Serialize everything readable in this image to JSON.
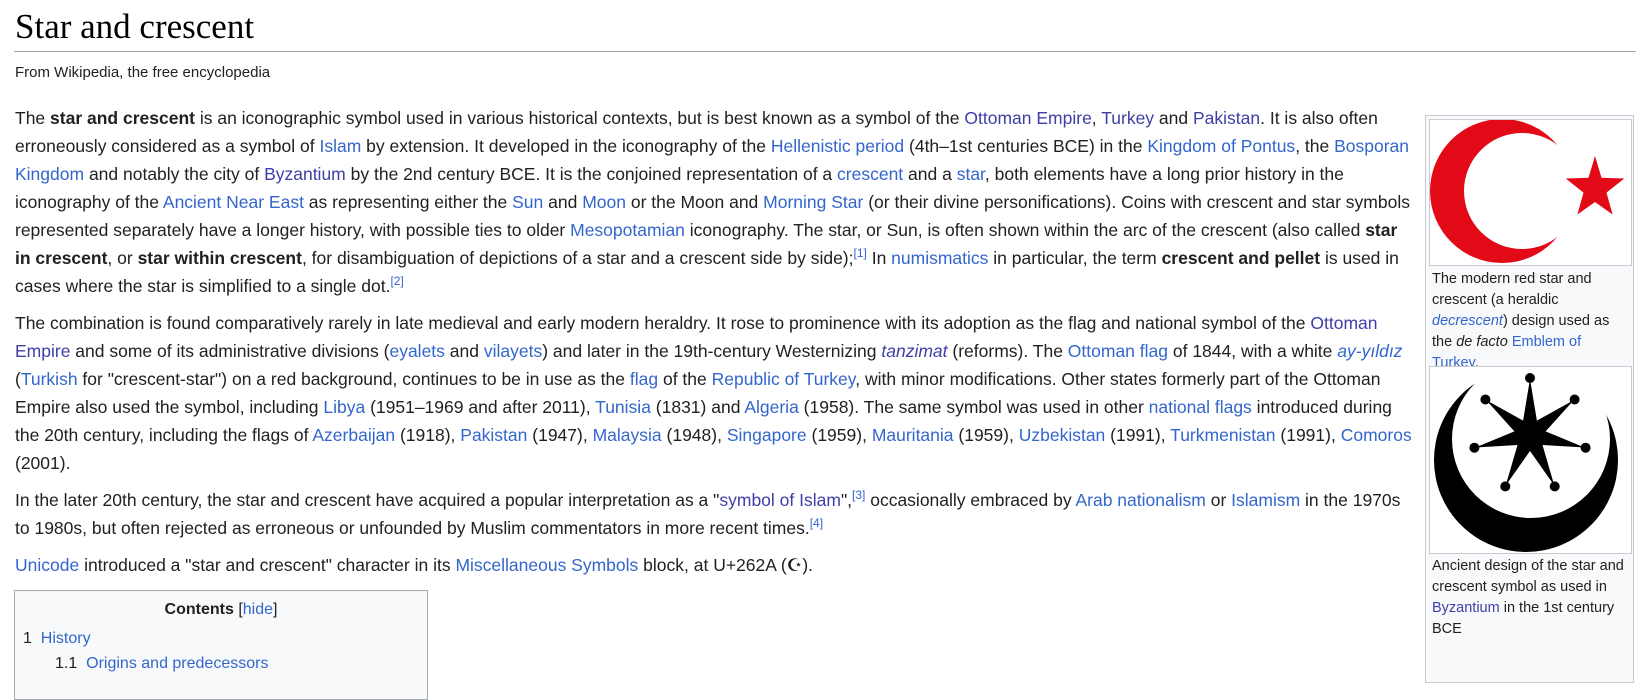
{
  "header": {
    "title": "Star and crescent",
    "tagline": "From Wikipedia, the free encyclopedia"
  },
  "para1": {
    "t1": "The ",
    "b1": "star and crescent",
    "t2": " is an iconographic symbol used in various historical contexts, but is best known as a symbol of the ",
    "l_ottoman": "Ottoman Empire",
    "t3": ", ",
    "l_turkey": "Turkey",
    "t4": " and ",
    "l_pakistan": "Pakistan",
    "t5": ". It is also often erroneously considered as a symbol of ",
    "l_islam": "Islam",
    "t6": " by extension. It developed in the iconography of the ",
    "l_hellenistic": "Hellenistic period",
    "t7": " (4th–1st centuries BCE) in the ",
    "l_pontus": "Kingdom of Pontus",
    "t8": ", the ",
    "l_bosporan": "Bosporan Kingdom",
    "t9": " and notably the city of ",
    "l_byzantium": "Byzantium",
    "t10": " by the 2nd century BCE. It is the conjoined representation of a ",
    "l_crescent": "crescent",
    "t11": " and a ",
    "l_star": "star",
    "t12": ", both elements have a long prior history in the iconography of the ",
    "l_ane": "Ancient Near East",
    "t13": " as representing either the ",
    "l_sun": "Sun",
    "t14": " and ",
    "l_moon": "Moon",
    "t15": " or the Moon and ",
    "l_morning": "Morning Star",
    "t16": " (or their divine personifications). Coins with crescent and star symbols represented separately have a longer history, with possible ties to older ",
    "l_meso": "Mesopotamian",
    "t17": " iconography. The star, or Sun, is often shown within the arc of the crescent (also called ",
    "b2": "star in crescent",
    "t18": ", or ",
    "b3": "star within crescent",
    "t19": ", for disambiguation of depictions of a star and a crescent side by side);",
    "ref1": "[1]",
    "t20": " In ",
    "l_numis": "numismatics",
    "t21": " in particular, the term ",
    "b4": "crescent and pellet",
    "t22": " is used in cases where the star is simplified to a single dot.",
    "ref2": "[2]"
  },
  "para2": {
    "t1": "The combination is found comparatively rarely in late medieval and early modern heraldry. It rose to prominence with its adoption as the flag and national symbol of the ",
    "l_ottoman": "Ottoman Empire",
    "t2": " and some of its administrative divisions (",
    "l_eyalets": "eyalets",
    "t3": " and ",
    "l_vilayets": "vilayets",
    "t4": ") and later in the 19th-century Westernizing ",
    "l_tanzimat": "tanzimat",
    "t5": " (reforms). The ",
    "l_oflag": "Ottoman flag",
    "t6": " of 1844, with a white ",
    "l_ay": "ay-yıldız",
    "t7": " (",
    "l_turkish": "Turkish",
    "t8": " for \"crescent-star\") on a red background, continues to be in use as the ",
    "l_flag": "flag",
    "t9": " of the ",
    "l_rot": "Republic of Turkey",
    "t10": ", with minor modifications. Other states formerly part of the Ottoman Empire also used the symbol, including ",
    "l_libya": "Libya",
    "t11": " (1951–1969 and after 2011), ",
    "l_tunisia": "Tunisia",
    "t12": " (1831) and ",
    "l_algeria": "Algeria",
    "t13": " (1958). The same symbol was used in other ",
    "l_nflags": "national flags",
    "t14": " introduced during the 20th century, including the flags of ",
    "l_azer": "Azerbaijan",
    "t15": " (1918), ",
    "l_pak": "Pakistan",
    "t16": " (1947), ",
    "l_malay": "Malaysia",
    "t17": " (1948), ",
    "l_sing": "Singapore",
    "t18": " (1959), ",
    "l_maur": "Mauritania",
    "t19": " (1959), ",
    "l_uzb": "Uzbekistan",
    "t20": " (1991), ",
    "l_turkm": "Turkmenistan",
    "t21": " (1991), ",
    "l_comoros": "Comoros",
    "t22": " (2001)."
  },
  "para3": {
    "t1": "In the later 20th century, the star and crescent have acquired a popular interpretation as a \"",
    "l_soi": "symbol of Islam",
    "t2": "\",",
    "ref3": "[3]",
    "t3": " occasionally embraced by ",
    "l_arab": "Arab nationalism",
    "t4": " or ",
    "l_islamism": "Islamism",
    "t5": " in the 1970s to 1980s, but often rejected as erroneous or unfounded by Muslim commentators in more recent times.",
    "ref4": "[4]"
  },
  "para4": {
    "l_unicode": "Unicode",
    "t1": " introduced a \"star and crescent\" character in its ",
    "l_misc": "Miscellaneous Symbols",
    "t2": " block, at U+262A (",
    "glyph": "☪",
    "t3": ")."
  },
  "infobox": {
    "cap1_t1": "The modern red star and crescent (a heraldic ",
    "cap1_i1": "decrescent",
    "cap1_t2": ") design used as the ",
    "cap1_i2": "de facto",
    "cap1_t3": " ",
    "cap1_l1": "Emblem of Turkey",
    "cap1_t4": ".",
    "cap2_t1": "Ancient design of the star and crescent symbol as used in ",
    "cap2_l1": "Byzantium",
    "cap2_t2": " in the 1st century BCE"
  },
  "toc": {
    "title": "Contents",
    "hide_open": "[",
    "hide": "hide",
    "hide_close": "]",
    "items": [
      {
        "num": "1",
        "label": "History"
      },
      {
        "num": "1.1",
        "label": "Origins and predecessors"
      }
    ]
  },
  "colors": {
    "link": "#3366cc",
    "visited_link": "#3e3ea6",
    "emblem_red": "#e30a17",
    "text": "#202122"
  }
}
